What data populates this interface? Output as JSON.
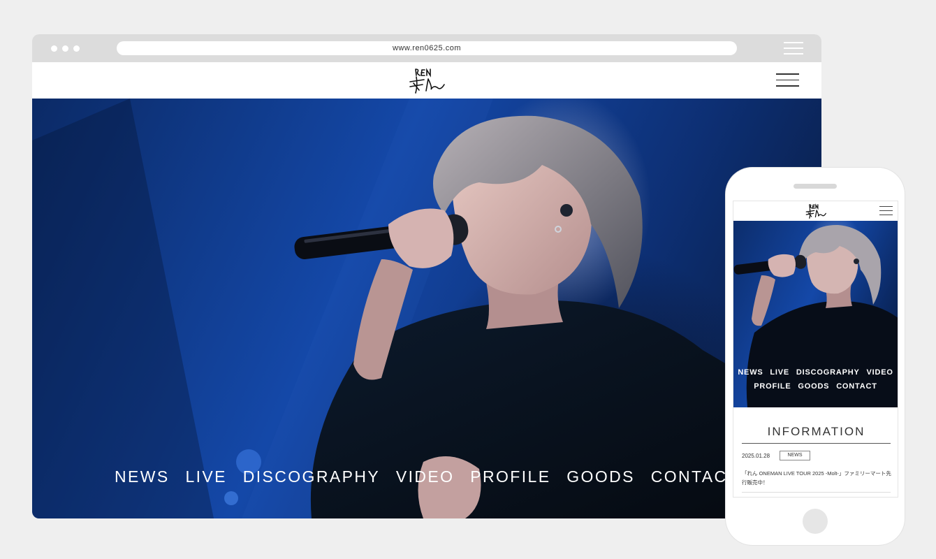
{
  "browser": {
    "url": "www.ren0625.com"
  },
  "site": {
    "logo_text": "REN れん",
    "nav": [
      "NEWS",
      "LIVE",
      "DISCOGRAPHY",
      "VIDEO",
      "PROFILE",
      "GOODS",
      "CONTACT"
    ]
  },
  "mobile": {
    "nav_row1": [
      "NEWS",
      "LIVE",
      "DISCOGRAPHY",
      "VIDEO"
    ],
    "nav_row2": [
      "PROFILE",
      "GOODS",
      "CONTACT"
    ],
    "info_title": "INFORMATION",
    "news": {
      "date": "2025.01.28",
      "category": "NEWS",
      "text": "「れん ONEMAN LIVE TOUR 2025 -Molt-」ファミリーマート先行販売中！"
    }
  },
  "colors": {
    "page_bg": "#efefef",
    "browser_bar": "#dcdcdc",
    "hero_blue": "#1448a8"
  }
}
